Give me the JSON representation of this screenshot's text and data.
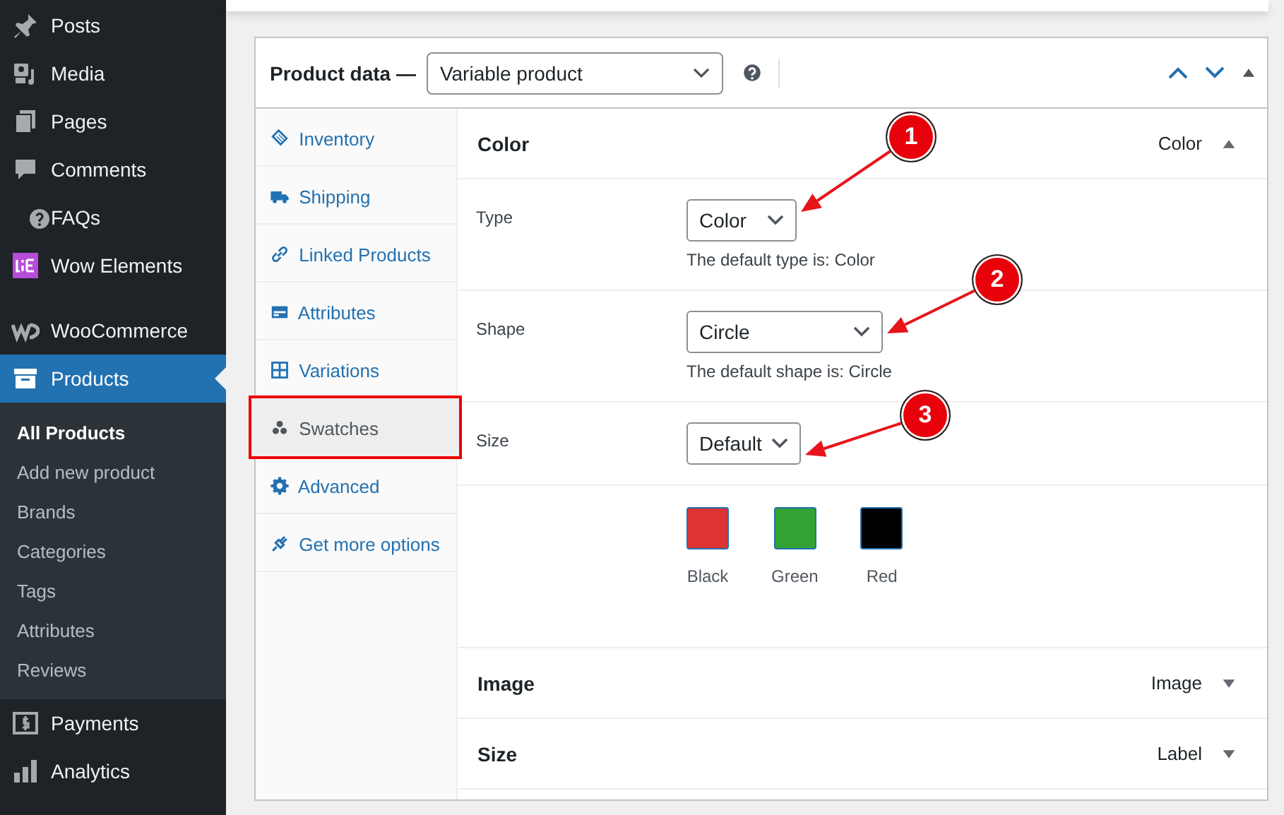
{
  "sidebar": {
    "items": [
      {
        "label": "Posts",
        "current": false
      },
      {
        "label": "Media",
        "current": false
      },
      {
        "label": "Pages",
        "current": false
      },
      {
        "label": "Comments",
        "current": false
      },
      {
        "label": "FAQs",
        "current": false
      },
      {
        "label": "Wow Elements",
        "current": false
      },
      {
        "label": "WooCommerce",
        "current": false
      },
      {
        "label": "Products",
        "current": true,
        "submenu": [
          {
            "label": "All Products",
            "selected": true
          },
          {
            "label": "Add new product",
            "selected": false
          },
          {
            "label": "Brands",
            "selected": false
          },
          {
            "label": "Categories",
            "selected": false
          },
          {
            "label": "Tags",
            "selected": false
          },
          {
            "label": "Attributes",
            "selected": false
          },
          {
            "label": "Reviews",
            "selected": false
          }
        ]
      },
      {
        "label": "Payments",
        "current": false
      },
      {
        "label": "Analytics",
        "current": false
      }
    ]
  },
  "panel": {
    "title": "Product data —",
    "product_type": "Variable product",
    "tabs": [
      {
        "label": "Inventory",
        "selected": false,
        "highlighted": false
      },
      {
        "label": "Shipping",
        "selected": false,
        "highlighted": false
      },
      {
        "label": "Linked Products",
        "selected": false,
        "highlighted": false
      },
      {
        "label": "Attributes",
        "selected": false,
        "highlighted": false
      },
      {
        "label": "Variations",
        "selected": false,
        "highlighted": false
      },
      {
        "label": "Swatches",
        "selected": true,
        "highlighted": true
      },
      {
        "label": "Advanced",
        "selected": false,
        "highlighted": false
      },
      {
        "label": "Get more options",
        "selected": false,
        "highlighted": false
      }
    ],
    "attributes": [
      {
        "name": "Color",
        "summary": "Color",
        "expanded": true,
        "fields": [
          {
            "label": "Type",
            "value": "Color",
            "help": "The default type is: Color"
          },
          {
            "label": "Shape",
            "value": "Circle",
            "help": "The default shape is: Circle"
          },
          {
            "label": "Size",
            "value": "Default"
          }
        ],
        "swatches": [
          {
            "name": "Black",
            "color": "#dd3333"
          },
          {
            "name": "Green",
            "color": "#33a333"
          },
          {
            "name": "Red",
            "color": "#000000"
          }
        ]
      },
      {
        "name": "Image",
        "summary": "Image",
        "expanded": false
      },
      {
        "name": "Size",
        "summary": "Label",
        "expanded": false
      }
    ]
  },
  "annotations": [
    {
      "number": "1"
    },
    {
      "number": "2"
    },
    {
      "number": "3"
    }
  ]
}
